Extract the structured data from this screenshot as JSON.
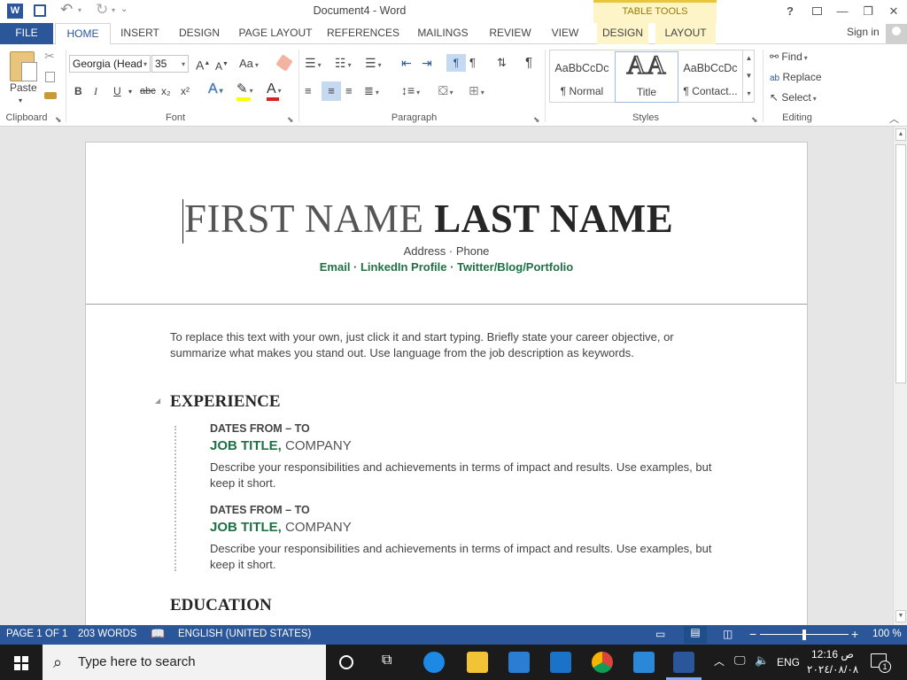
{
  "window": {
    "title": "Document4 - Word",
    "table_tools": "TABLE TOOLS",
    "help": "?",
    "sign_in": "Sign in"
  },
  "tabs": [
    "FILE",
    "HOME",
    "INSERT",
    "DESIGN",
    "PAGE LAYOUT",
    "REFERENCES",
    "MAILINGS",
    "REVIEW",
    "VIEW",
    "DESIGN",
    "LAYOUT"
  ],
  "ribbon": {
    "clipboard": {
      "paste": "Paste",
      "label": "Clipboard"
    },
    "font": {
      "name": "Georgia (Head",
      "size": "35",
      "change_case": "Aa",
      "bold": "B",
      "italic": "I",
      "underline": "U",
      "strike": "abc",
      "sub": "x₂",
      "sup": "x²",
      "label": "Font"
    },
    "paragraph": {
      "label": "Paragraph"
    },
    "styles": {
      "items": [
        {
          "sample": "AaBbCcDc",
          "name": "¶ Normal"
        },
        {
          "sample": "AA",
          "name": "Title"
        },
        {
          "sample": "AaBbCcDc",
          "name": "¶ Contact..."
        }
      ],
      "label": "Styles"
    },
    "editing": {
      "find": "Find",
      "replace": "Replace",
      "select": "Select",
      "label": "Editing"
    }
  },
  "document": {
    "first_name": "FIRST NAME",
    "last_name": "LAST NAME",
    "address": "Address · Phone",
    "links": "Email · LinkedIn Profile · Twitter/Blog/Portfolio",
    "objective": "To replace this text with your own, just click it and start typing. Briefly state your career objective, or summarize what makes you stand out. Use language from the job description as keywords.",
    "experience_heading": "EXPERIENCE",
    "jobs": [
      {
        "dates": "DATES FROM – TO",
        "title": "JOB TITLE,",
        "company": "COMPANY",
        "desc": "Describe your responsibilities and achievements in terms of impact and results. Use examples, but keep it short."
      },
      {
        "dates": "DATES FROM – TO",
        "title": "JOB TITLE,",
        "company": "COMPANY",
        "desc": "Describe your responsibilities and achievements in terms of impact and results. Use examples, but keep it short."
      }
    ],
    "education_heading": "EDUCATION"
  },
  "status": {
    "page": "PAGE 1 OF 1",
    "words": "203 WORDS",
    "language": "ENGLISH (UNITED STATES)",
    "zoom_text": "100 %",
    "zoom": 100
  },
  "taskbar": {
    "search_placeholder": "Type here to search",
    "lang": "ENG",
    "time": "12:16 ص",
    "date": "٢٠٢٤/٠٨/٠٨",
    "notifications": "1"
  },
  "colors": {
    "accent": "#2b579a",
    "green": "#1e7145",
    "tabletools": "#fdf4c8"
  }
}
